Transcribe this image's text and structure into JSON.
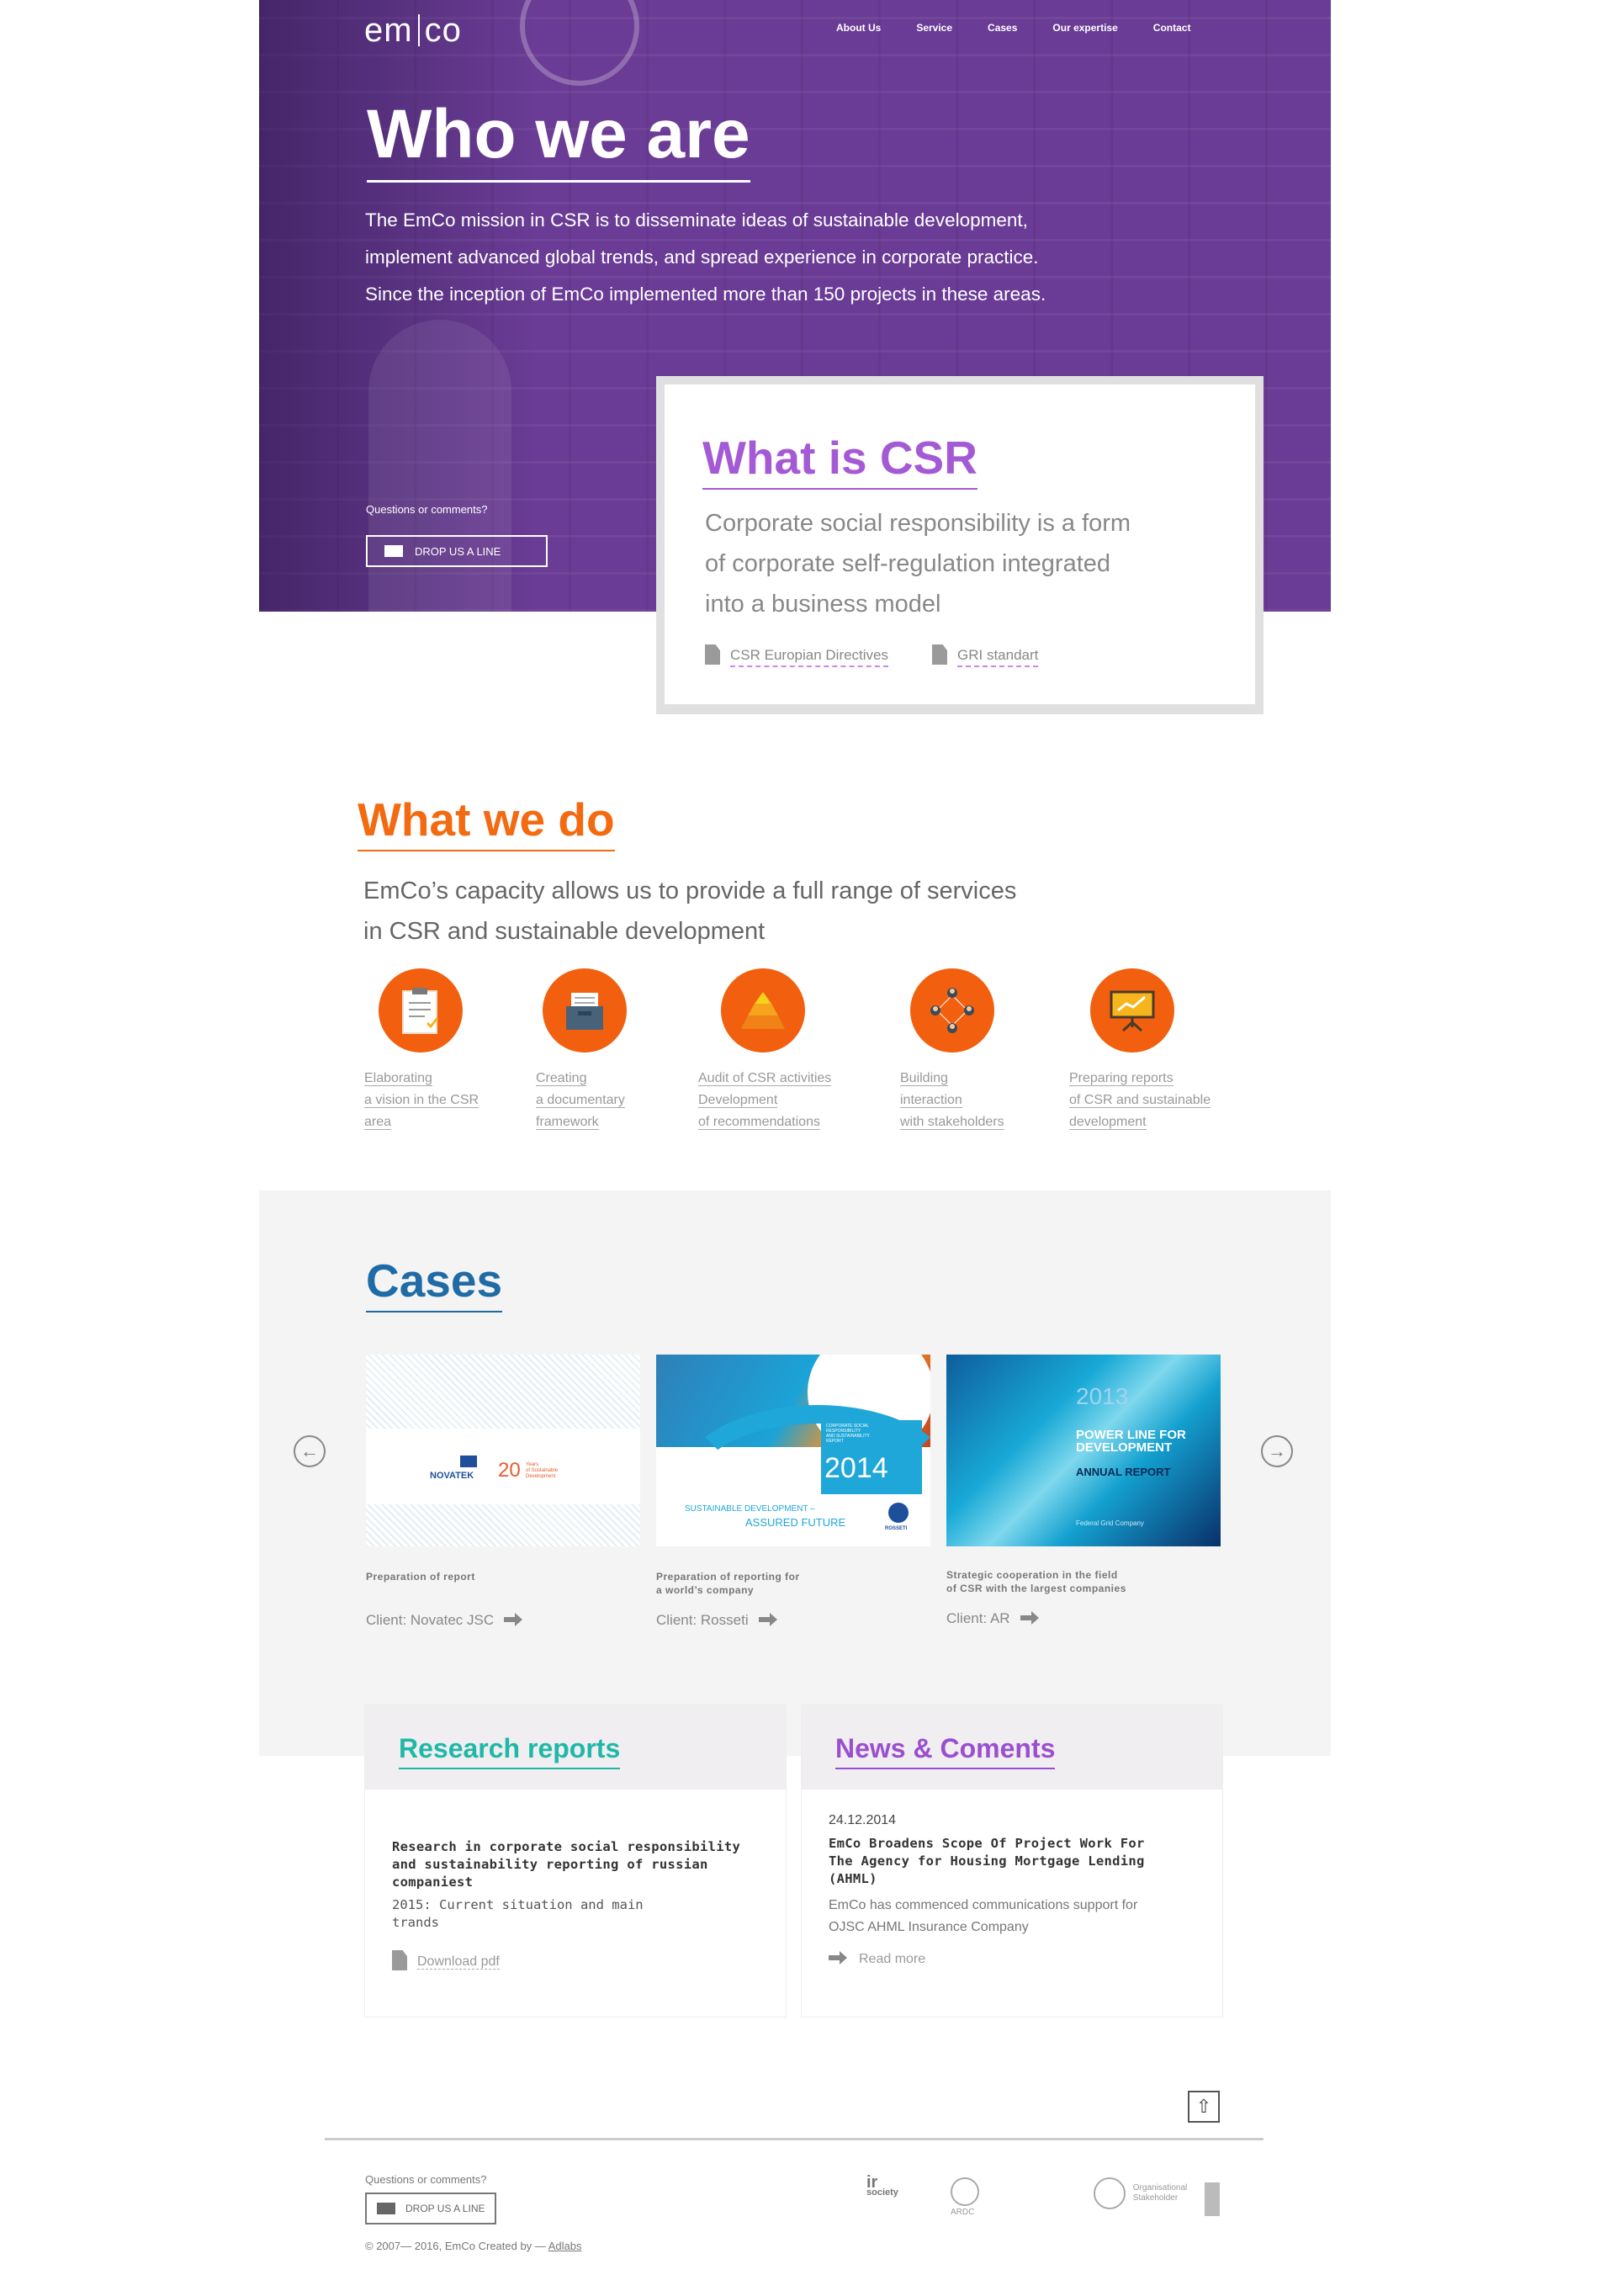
{
  "header": {
    "logo_left": "em",
    "logo_right": "co",
    "nav": [
      "About Us",
      "Service",
      "Cases",
      "Our expertise",
      "Contact"
    ]
  },
  "hero": {
    "title": "Who we are",
    "paragraph_lines": [
      "The EmCo mission in CSR is to disseminate ideas of sustainable development,",
      "implement advanced global trends, and spread experience in corporate practice.",
      "Since the inception of EmCo implemented more than 150 projects in these areas."
    ],
    "questions": "Questions or comments?",
    "drop_button": "DROP US A LINE"
  },
  "csr": {
    "title": "What is CSR",
    "text_lines": [
      "Corporate social responsibility is a form",
      "of corporate self-regulation integrated",
      "into a business model"
    ],
    "links": [
      "CSR Europian Directives",
      "GRI standart"
    ]
  },
  "what_we_do": {
    "title": "What we do",
    "text_lines": [
      "EmCo’s capacity allows us to provide a full range of services",
      "in CSR and sustainable development"
    ],
    "services": [
      {
        "icon": "clipboard-icon",
        "lines": [
          "Elaborating",
          "a vision in the CSR",
          "area"
        ]
      },
      {
        "icon": "document-box-icon",
        "lines": [
          "Creating",
          "a documentary",
          "framework"
        ]
      },
      {
        "icon": "pyramid-icon",
        "lines": [
          "Audit of CSR activities",
          "Development",
          "of recommendations"
        ]
      },
      {
        "icon": "people-network-icon",
        "lines": [
          "Building",
          "interaction",
          "with stakeholders"
        ]
      },
      {
        "icon": "presentation-board-icon",
        "lines": [
          "Preparing reports",
          "of CSR and sustainable",
          "development"
        ]
      }
    ]
  },
  "cases": {
    "title": "Cases",
    "items": [
      {
        "caption": [
          "Preparation of report"
        ],
        "client": "Client: Novatec JSC",
        "cover": {
          "brand": "NOVATEK",
          "number": "20",
          "tag_lines": [
            "Years",
            "of Sustainable",
            "Development"
          ]
        }
      },
      {
        "caption": [
          "Preparation of reporting for",
          "a world’s company"
        ],
        "client": "Client: Rosseti",
        "cover": {
          "year": "2014",
          "heading_lines": [
            "CORPORATE SOCIAL",
            "RESPONSIBILITY",
            "AND SUSTAINABILITY",
            "REPORT"
          ],
          "tagline_1": "SUSTAINABLE DEVELOPMENT –",
          "tagline_2": "ASSURED FUTURE",
          "brand": "ROSSETI"
        }
      },
      {
        "caption": [
          "Strategic cooperation in the field",
          "of CSR with the largest companies"
        ],
        "client": "Client: AR",
        "cover": {
          "year": "2013",
          "heading_lines": [
            "POWER LINE FOR",
            "DEVELOPMENT"
          ],
          "sub": "ANNUAL REPORT",
          "brand": "Federal Grid Company"
        }
      }
    ]
  },
  "research": {
    "title": "Research reports",
    "heading_lines": [
      "Research in corporate social responsibility",
      "and sustainability reporting of russian",
      "companiest"
    ],
    "sub_lines": [
      "2015: Current situation and main",
      "trands"
    ],
    "download": "Download pdf"
  },
  "news": {
    "title": "News & Coments",
    "date": "24.12.2014",
    "heading_lines": [
      "EmCo Broadens Scope Of Project Work For",
      "The Agency for Housing Mortgage Lending",
      "(AHML)"
    ],
    "text_lines": [
      "EmCo has commenced communications support for",
      "OJSC AHML Insurance Company"
    ],
    "read_more": "Read more"
  },
  "footer": {
    "questions": "Questions or comments?",
    "drop_button": "DROP US A LINE",
    "copyright": "© 2007— 2016, EmCo  Created by — ",
    "creator": "Adlabs",
    "partners": {
      "irsociety": [
        "ir",
        "society"
      ],
      "arsc": "ARDC",
      "gri": [
        "Organisational",
        "Stakeholder"
      ]
    }
  },
  "colors": {
    "hero_purple": "#6a3c95",
    "csr_purple": "#a55ad5",
    "orange": "#f36a10",
    "blue": "#1f6ba6",
    "teal": "#1fb8a8",
    "news_purple": "#9b4fd0"
  }
}
